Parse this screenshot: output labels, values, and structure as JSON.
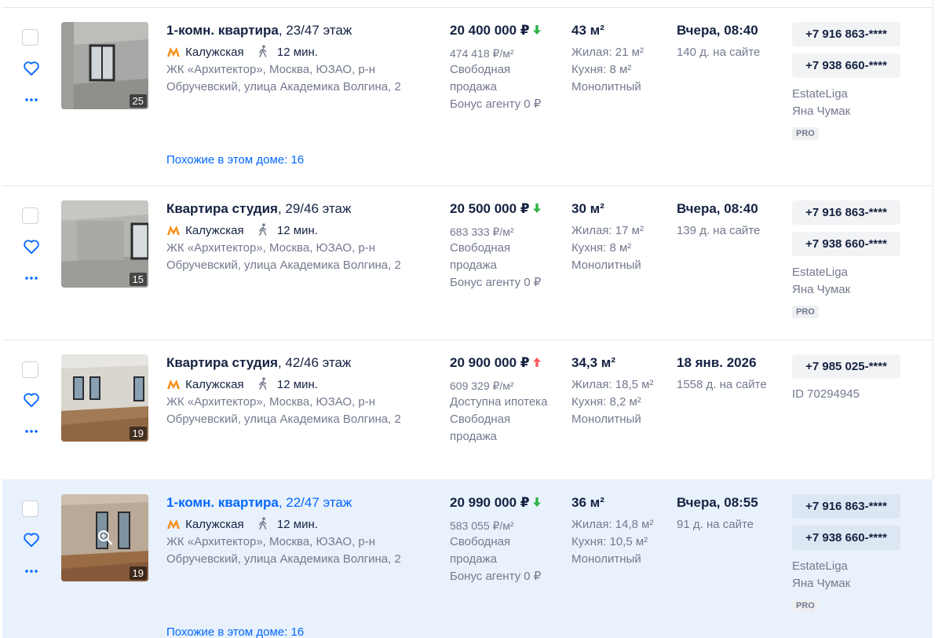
{
  "listings": [
    {
      "photo_count": "25",
      "title_main": "1-комн. квартира",
      "title_sub": ", 23/47 этаж",
      "metro": "Калужская",
      "walk": "12 мин.",
      "address_line1": "ЖК «Архитектор», Москва, ЮЗАО, р-н",
      "address_line2": "Обручевский, улица Академика Волгина, 2",
      "price": "20 400 000 ₽",
      "price_trend": "down",
      "price_per_m": "474 418 ₽/м²",
      "sale_line1": "Свободная",
      "sale_line2": "продажа",
      "bonus": "Бонус агенту 0 ₽",
      "area": "43 м²",
      "living": "Жилая: 21 м²",
      "kitchen": "Кухня: 8 м²",
      "building": "Монолитный",
      "date": "Вчера, 08:40",
      "on_site": "140 д. на сайте",
      "phone1": "+7 916 863-****",
      "phone2": "+7 938 660-****",
      "agency": "EstateLiga",
      "agent": "Яна Чумак",
      "badge": "PRO",
      "similar": "Похожие в этом доме: 16"
    },
    {
      "photo_count": "15",
      "title_main": "Квартира студия",
      "title_sub": ", 29/46 этаж",
      "metro": "Калужская",
      "walk": "12 мин.",
      "address_line1": "ЖК «Архитектор», Москва, ЮЗАО, р-н",
      "address_line2": "Обручевский, улица Академика Волгина, 2",
      "price": "20 500 000 ₽",
      "price_trend": "down",
      "price_per_m": "683 333 ₽/м²",
      "sale_line1": "Свободная",
      "sale_line2": "продажа",
      "bonus": "Бонус агенту 0 ₽",
      "area": "30 м²",
      "living": "Жилая: 17 м²",
      "kitchen": "Кухня: 8 м²",
      "building": "Монолитный",
      "date": "Вчера, 08:40",
      "on_site": "139 д. на сайте",
      "phone1": "+7 916 863-****",
      "phone2": "+7 938 660-****",
      "agency": "EstateLiga",
      "agent": "Яна Чумак",
      "badge": "PRO"
    },
    {
      "photo_count": "19",
      "title_main": "Квартира студия",
      "title_sub": ", 42/46 этаж",
      "metro": "Калужская",
      "walk": "12 мин.",
      "address_line1": "ЖК «Архитектор», Москва, ЮЗАО, р-н",
      "address_line2": "Обручевский, улица Академика Волгина, 2",
      "price": "20 900 000 ₽",
      "price_trend": "up",
      "price_per_m": "609 329 ₽/м²",
      "mortgage": "Доступна ипотека",
      "sale_line1": "Свободная",
      "sale_line2": "продажа",
      "area": "34,3 м²",
      "living": "Жилая: 18,5 м²",
      "kitchen": "Кухня: 8,2 м²",
      "building": "Монолитный",
      "date": "18 янв. 2026",
      "on_site": "1558 д. на сайте",
      "phone1": "+7 985 025-****",
      "listing_id": "ID 70294945"
    },
    {
      "photo_count": "19",
      "title_main": "1-комн. квартира",
      "title_sub": ", 22/47 этаж",
      "metro": "Калужская",
      "walk": "12 мин.",
      "address_line1": "ЖК «Архитектор», Москва, ЮЗАО, р-н",
      "address_line2": "Обручевский, улица Академика Волгина, 2",
      "price": "20 990 000 ₽",
      "price_trend": "down",
      "price_per_m": "583 055 ₽/м²",
      "sale_line1": "Свободная",
      "sale_line2": "продажа",
      "bonus": "Бонус агенту 0 ₽",
      "area": "36 м²",
      "living": "Жилая: 14,8 м²",
      "kitchen": "Кухня: 10,5 м²",
      "building": "Монолитный",
      "date": "Вчера, 08:55",
      "on_site": "91 д. на сайте",
      "phone1": "+7 916 863-****",
      "phone2": "+7 938 660-****",
      "agency": "EstateLiga",
      "agent": "Яна Чумак",
      "badge": "PRO",
      "similar": "Похожие в этом доме: 16"
    }
  ],
  "colors": {
    "price_down": "#2fb344",
    "price_up": "#ff5a5f",
    "metro": "#f7921e",
    "link": "#0468ff",
    "highlight": "#e8f1fc"
  }
}
